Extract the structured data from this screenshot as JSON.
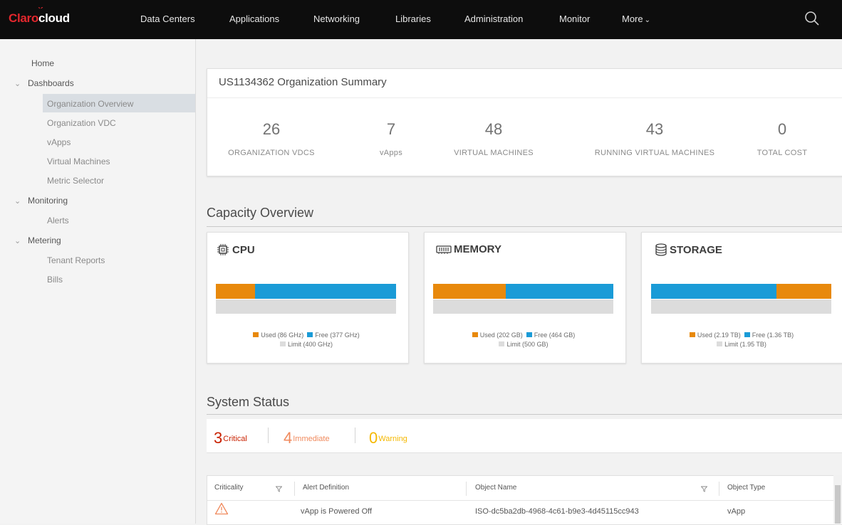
{
  "brand": {
    "claro": "Claro",
    "cloud": "cloud",
    "mark": "ˋ´"
  },
  "nav": {
    "items": [
      "Data Centers",
      "Applications",
      "Networking",
      "Libraries",
      "Administration",
      "Monitor",
      "More"
    ],
    "search_icon": "search-icon"
  },
  "sidebar": {
    "home": "Home",
    "dashboards": "Dashboards",
    "dashboard_items": [
      "Organization Overview",
      "Organization VDC",
      "vApps",
      "Virtual Machines",
      "Metric Selector"
    ],
    "monitoring": "Monitoring",
    "monitoring_items": [
      "Alerts"
    ],
    "metering": "Metering",
    "metering_items": [
      "Tenant Reports",
      "Bills"
    ],
    "active_item": "Organization Overview"
  },
  "summary": {
    "title": "US1134362 Organization Summary",
    "stats": [
      {
        "value": "26",
        "label": "ORGANIZATION VDCS"
      },
      {
        "value": "7",
        "label": "vApps"
      },
      {
        "value": "48",
        "label": "VIRTUAL MACHINES"
      },
      {
        "value": "43",
        "label": "RUNNING VIRTUAL MACHINES"
      },
      {
        "value": "0",
        "label": "TOTAL COST"
      }
    ]
  },
  "capacity": {
    "title": "Capacity Overview",
    "colors": {
      "used": "#e8890c",
      "free": "#1a9bd7",
      "limit": "#dcdcdc"
    },
    "cards": [
      {
        "title": "CPU",
        "icon": "cpu-icon",
        "used_label": "Used (86 GHz)",
        "free_label": "Free (377 GHz)",
        "limit_label": "Limit (400 GHz)"
      },
      {
        "title": "MEMORY",
        "icon": "memory-icon",
        "used_label": "Used (202 GB)",
        "free_label": "Free (464 GB)",
        "limit_label": "Limit (500 GB)"
      },
      {
        "title": "STORAGE",
        "icon": "storage-icon",
        "used_label": "Used (2.19 TB)",
        "free_label": "Free (1.36 TB)",
        "limit_label": "Limit (1.95 TB)"
      }
    ]
  },
  "system_status": {
    "title": "System Status",
    "critical": {
      "count": "3",
      "label": "Critical",
      "color": "#c92100"
    },
    "immediate": {
      "count": "4",
      "label": "Immediate",
      "color": "#f08a5d"
    },
    "warning": {
      "count": "0",
      "label": "Warning",
      "color": "#f5b800"
    }
  },
  "alerts_table": {
    "columns": [
      "Criticality",
      "Alert Definition",
      "Object Name",
      "Object Type"
    ],
    "rows": [
      {
        "criticality_icon": "warning-icon",
        "alert_definition": "vApp is Powered Off",
        "object_name": "ISO-dc5ba2db-4968-4c61-b9e3-4d45115cc943",
        "object_type": "vApp"
      }
    ]
  }
}
